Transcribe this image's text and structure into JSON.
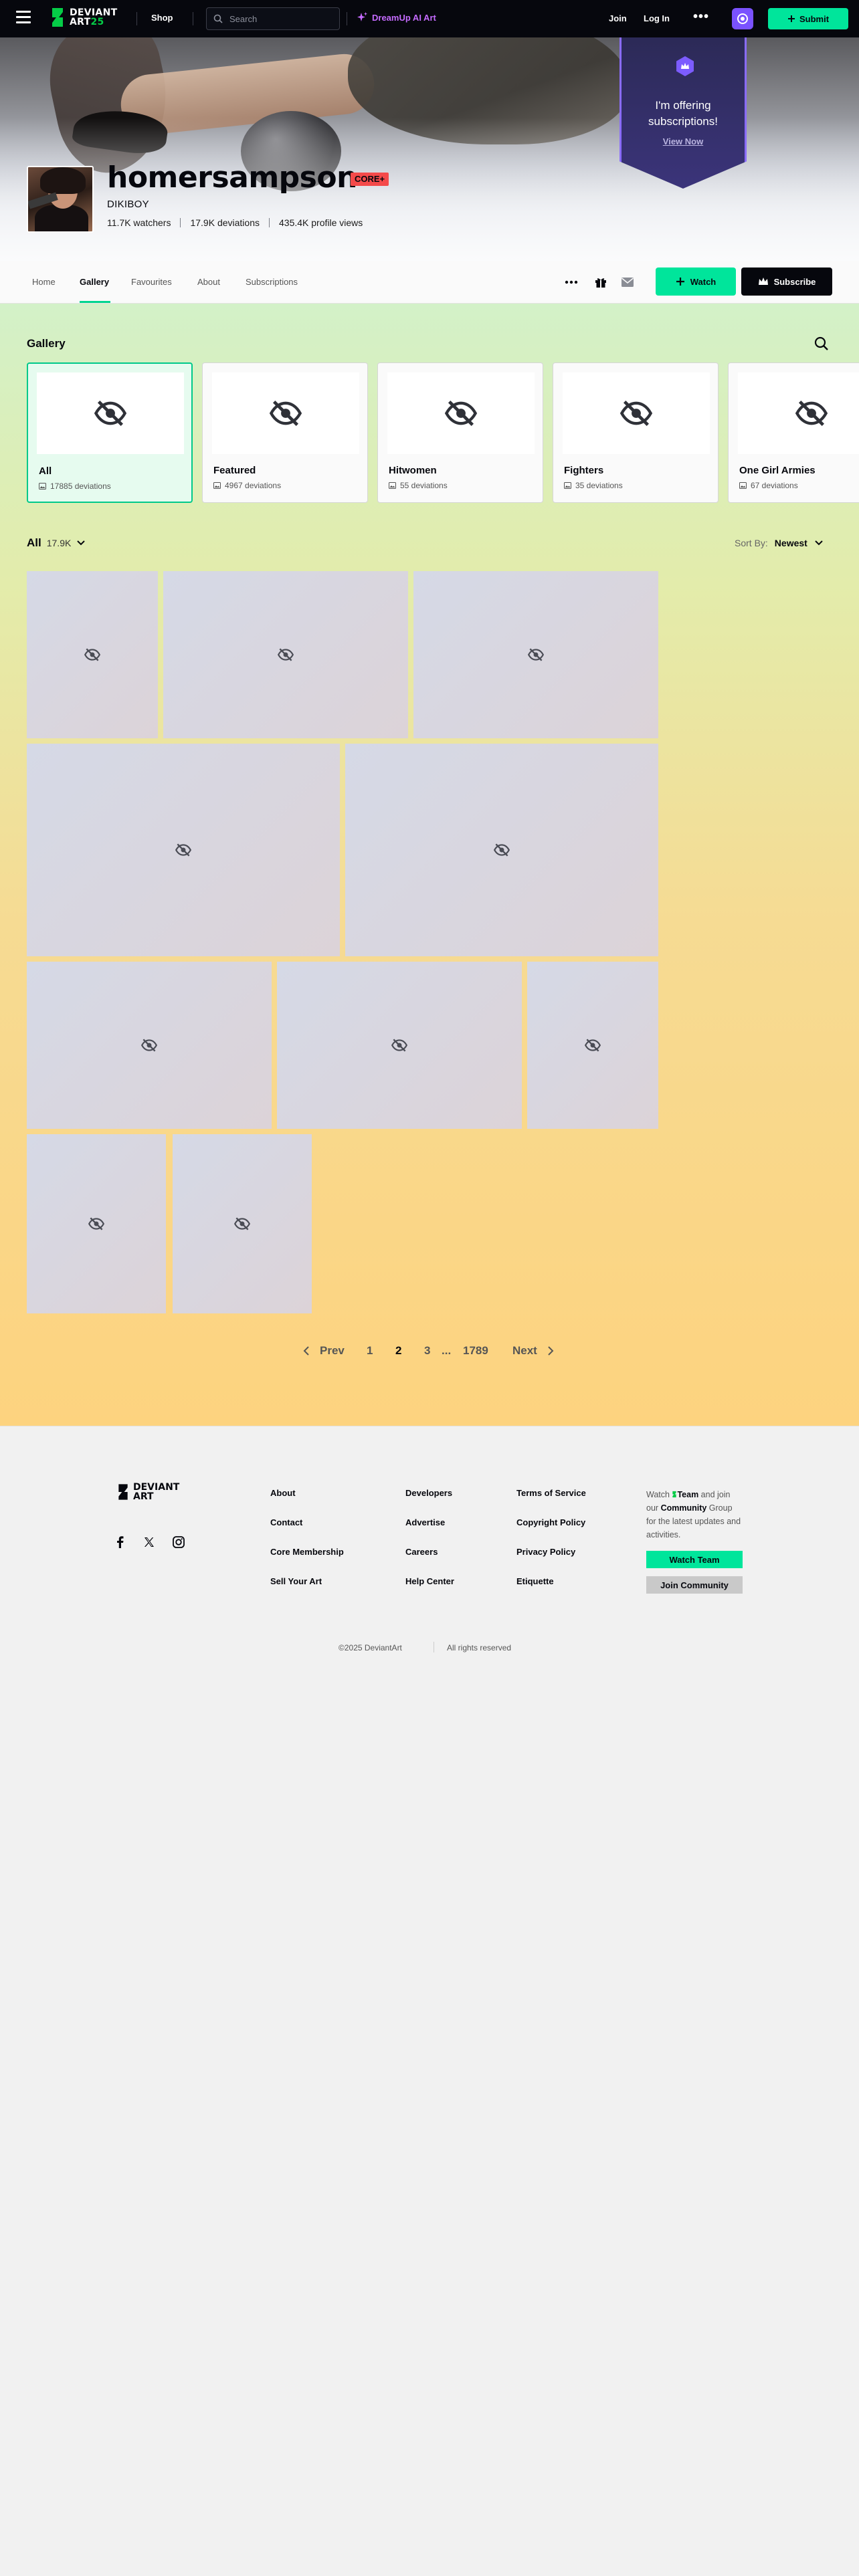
{
  "topnav": {
    "logo_line1": "DEVIANT",
    "logo_line2_a": "ART",
    "logo_line2_b": "25",
    "shop": "Shop",
    "search_placeholder": "Search",
    "dreamup": "DreamUp AI Art",
    "join": "Join",
    "login": "Log In",
    "more": "•••",
    "submit": "Submit",
    "accent": "#00e59b"
  },
  "hero": {
    "offer_text": "I'm offering subscriptions!",
    "view_now": "View Now"
  },
  "profile": {
    "username": "homersampson",
    "core_tag": "CORE+",
    "realname": "DIKIBOY",
    "watchers": "11.7K watchers",
    "deviations": "17.9K deviations",
    "profile_views": "435.4K profile views"
  },
  "tabs": {
    "home": "Home",
    "gallery": "Gallery",
    "favourites": "Favourites",
    "about": "About",
    "subscriptions": "Subscriptions",
    "watch": "Watch",
    "subscribe": "Subscribe"
  },
  "gallery": {
    "title": "Gallery",
    "folders": [
      {
        "name": "All",
        "count": "17885 deviations"
      },
      {
        "name": "Featured",
        "count": "4967 deviations"
      },
      {
        "name": "Hitwomen",
        "count": "55 deviations"
      },
      {
        "name": "Fighters",
        "count": "35 deviations"
      },
      {
        "name": "One Girl Armies",
        "count": "67 deviations"
      }
    ],
    "filter_label": "All",
    "filter_count": "17.9K",
    "sort_label": "Sort By:",
    "sort_value": "Newest",
    "tile_icon": "eye-slash-icon"
  },
  "pagination": {
    "prev": "Prev",
    "pages": [
      "1",
      "2",
      "3"
    ],
    "ellipsis": "...",
    "last": "1789",
    "next": "Next",
    "current": "2"
  },
  "footer": {
    "logo_line1": "DEVIANT",
    "logo_line2": "ART",
    "col1": [
      "About",
      "Contact",
      "Core Membership",
      "Sell Your Art"
    ],
    "col2": [
      "Developers",
      "Advertise",
      "Careers",
      "Help Center"
    ],
    "col3": [
      "Terms of Service",
      "Copyright Policy",
      "Privacy Policy",
      "Etiquette"
    ],
    "watch_prefix": "Watch",
    "watch_team": "Team",
    "watch_mid": "and join our",
    "community": "Community",
    "watch_suffix": "Group for the latest updates and activities.",
    "watch_team_button": "Watch Team",
    "join_community_button": "Join Community",
    "copyright": "©2025 DeviantArt",
    "rights": "All rights reserved"
  }
}
